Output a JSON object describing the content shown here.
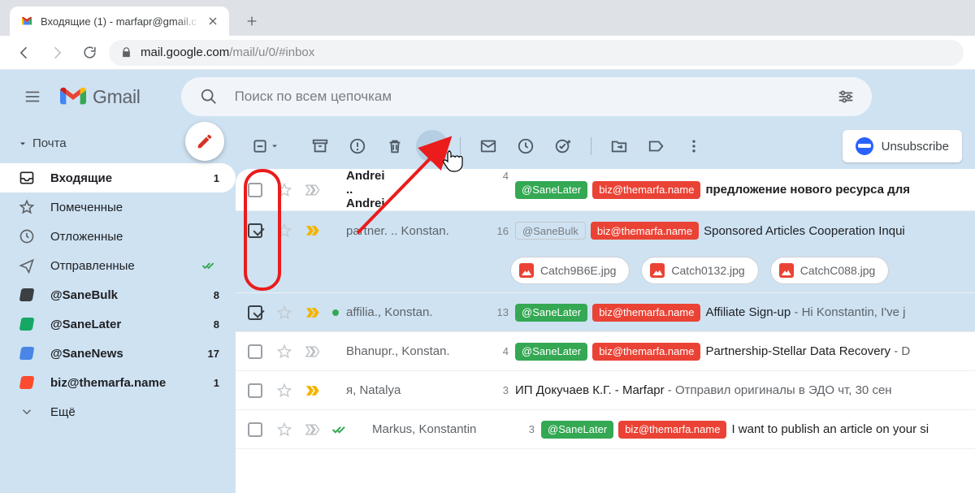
{
  "browser": {
    "tabTitle": "Входящие (1) - marfapr@gmail.c",
    "urlHost": "mail.google.com",
    "urlPath": "/mail/u/0/#inbox"
  },
  "header": {
    "logoText": "Gmail",
    "searchPlaceholder": "Поиск по всем цепочкам"
  },
  "sidebar": {
    "sectionLabel": "Почта",
    "more": "Ещё",
    "items": [
      {
        "icon": "inbox",
        "label": "Входящие",
        "count": "1",
        "active": true,
        "bold": true
      },
      {
        "icon": "star",
        "label": "Помеченные"
      },
      {
        "icon": "clock",
        "label": "Отложенные"
      },
      {
        "icon": "send",
        "label": "Отправленные",
        "trailing": "doublecheck"
      },
      {
        "icon": "label",
        "color": "#3c4043",
        "label": "@SaneBulk",
        "count": "8",
        "bold": true
      },
      {
        "icon": "label",
        "color": "#16a765",
        "label": "@SaneLater",
        "count": "8",
        "bold": true
      },
      {
        "icon": "label",
        "color": "#4986e7",
        "label": "@SaneNews",
        "count": "17",
        "bold": true
      },
      {
        "icon": "label",
        "color": "#fb4c2f",
        "label": "biz@themarfa.name",
        "count": "1",
        "bold": true
      }
    ]
  },
  "toolbar": {
    "unsubscribe": "Unsubscribe"
  },
  "emails": [
    {
      "selected": false,
      "unread": true,
      "important": "outline",
      "senders": [
        {
          "t": "Andrei"
        },
        {
          "t": ".. "
        },
        {
          "t": "Andrei",
          "b": true
        }
      ],
      "count": "4",
      "chips": [
        {
          "t": "@SaneLater",
          "c": "green"
        },
        {
          "t": "biz@themarfa.name",
          "c": "red"
        }
      ],
      "subject": "предложение нового ресурса для"
    },
    {
      "selected": true,
      "unread": false,
      "important": "yellow",
      "senders": [
        {
          "t": "partner. .. Konstan."
        }
      ],
      "count": "16",
      "chips": [
        {
          "t": "@SaneBulk",
          "c": "grey"
        },
        {
          "t": "biz@themarfa.name",
          "c": "red"
        }
      ],
      "subject": "Sponsored Articles Cooperation Inqui",
      "attachments": [
        "Catch9B6E.jpg",
        "Catch0132.jpg",
        "CatchC088.jpg"
      ]
    },
    {
      "selected": true,
      "unread": false,
      "important": "yellow",
      "greendot": true,
      "senders": [
        {
          "t": "affilia., Konstan."
        }
      ],
      "count": "13",
      "chips": [
        {
          "t": "@SaneLater",
          "c": "green"
        },
        {
          "t": "biz@themarfa.name",
          "c": "red"
        }
      ],
      "subject": "Affiliate Sign-up",
      "snippet": " - Hi Konstantin, I've j"
    },
    {
      "selected": false,
      "unread": false,
      "important": "outline",
      "senders": [
        {
          "t": "Bhanupr., Konstan."
        }
      ],
      "count": "4",
      "chips": [
        {
          "t": "@SaneLater",
          "c": "green"
        },
        {
          "t": "biz@themarfa.name",
          "c": "red"
        }
      ],
      "subject": "Partnership-Stellar Data Recovery",
      "snippet": " - D"
    },
    {
      "selected": false,
      "unread": false,
      "important": "yellow",
      "senders": [
        {
          "t": "я, Natalya"
        }
      ],
      "count": "3",
      "subject": "ИП Докучаев К.Г. - Marfapr",
      "snippet": " - Отправил оригиналы в ЭДО чт, 30 сен"
    },
    {
      "selected": false,
      "unread": false,
      "important": "outline",
      "doublecheck": true,
      "senders": [
        {
          "t": "Markus, Konstantin"
        }
      ],
      "count": "3",
      "chips": [
        {
          "t": "@SaneLater",
          "c": "green"
        },
        {
          "t": "biz@themarfa.name",
          "c": "red"
        }
      ],
      "subject": "I want to publish an article on your si"
    }
  ]
}
